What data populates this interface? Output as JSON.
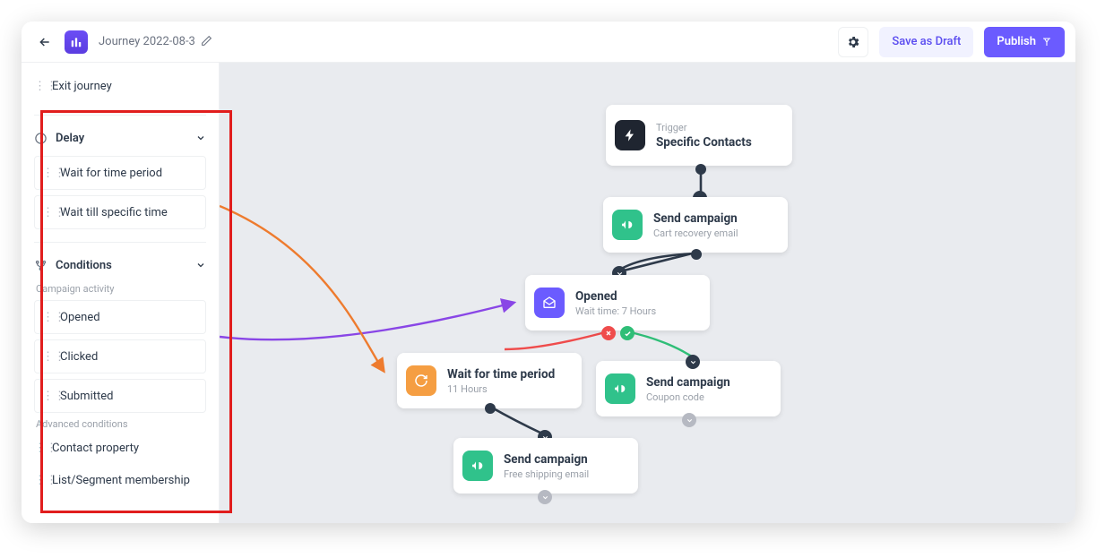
{
  "header": {
    "title": "Journey 2022-08-3",
    "save_draft": "Save as Draft",
    "publish": "Publish"
  },
  "sidebar": {
    "exit": "Exit journey",
    "sections": {
      "delay": {
        "label": "Delay",
        "items": [
          "Wait for time period",
          "Wait till specific time"
        ]
      },
      "conditions": {
        "label": "Conditions",
        "group1_label": "Campaign activity",
        "group1_items": [
          "Opened",
          "Clicked",
          "Submitted"
        ],
        "group2_label": "Advanced conditions",
        "group2_items": [
          "Contact property",
          "List/Segment membership"
        ]
      }
    }
  },
  "nodes": {
    "trigger": {
      "kicker": "Trigger",
      "title": "Specific Contacts"
    },
    "send1": {
      "title": "Send campaign",
      "sub": "Cart recovery email"
    },
    "opened": {
      "title": "Opened",
      "sub": "Wait time: 7 Hours"
    },
    "wait": {
      "title": "Wait for time period",
      "sub": "11 Hours"
    },
    "send2": {
      "title": "Send campaign",
      "sub": "Coupon code"
    },
    "send3": {
      "title": "Send campaign",
      "sub": "Free shipping email"
    }
  }
}
